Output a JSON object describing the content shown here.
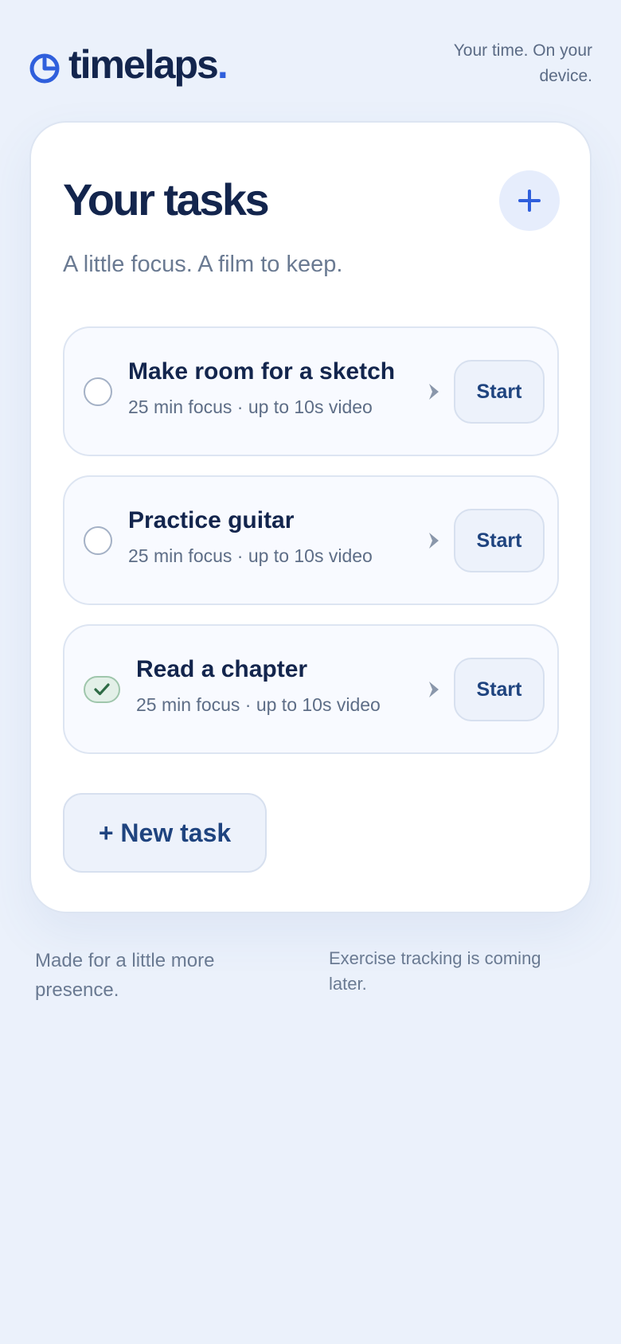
{
  "brand": {
    "name": "timelaps",
    "dot": ".",
    "icon": "clock-pie-icon",
    "accent_color": "#2f5fdc"
  },
  "header": {
    "tagline": "Your time. On your device."
  },
  "card": {
    "title": "Your tasks",
    "subtitle": "A little focus. A film to keep.",
    "add_button_icon": "plus-icon"
  },
  "tasks": [
    {
      "name": "Make room for a sketch",
      "meta": "25 min focus · up to 10s video",
      "done": false,
      "action_label": "Start"
    },
    {
      "name": "Practice guitar",
      "meta": "25 min focus · up to 10s video",
      "done": false,
      "action_label": "Start"
    },
    {
      "name": "Read a chapter",
      "meta": "25 min focus · up to 10s video",
      "done": true,
      "action_label": "Start"
    }
  ],
  "new_task_label": "+ New task",
  "footer": {
    "left": "Made for a little more presence.",
    "right": "Exercise tracking is coming later."
  },
  "colors": {
    "background": "#ebf1fb",
    "text_primary": "#13254d",
    "text_secondary": "#6a7a92",
    "done_green": "#2e6b45"
  }
}
